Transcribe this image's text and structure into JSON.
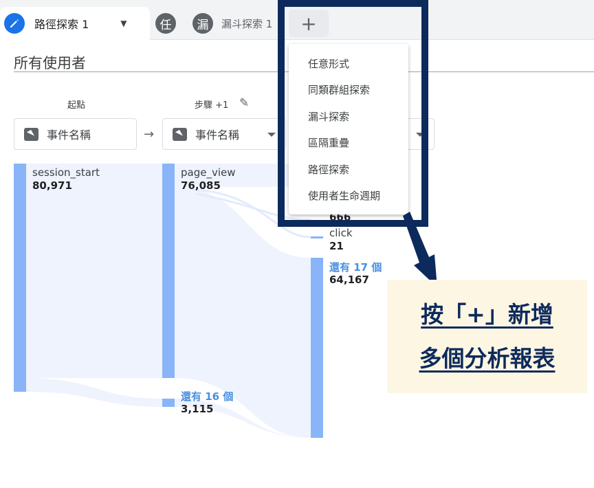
{
  "tabs": [
    {
      "badge": "",
      "label": "路徑探索 1",
      "active": true
    },
    {
      "badge": "任",
      "label": "",
      "active": false
    },
    {
      "badge": "漏",
      "label": "漏斗探索 1",
      "active": false
    }
  ],
  "add_tab_label": "+",
  "segment_title": "所有使用者",
  "steps": [
    {
      "title": "起點",
      "selector": "事件名稱"
    },
    {
      "title": "步驟 +1",
      "selector": "事件名稱"
    }
  ],
  "nodes": {
    "start": {
      "label": "session_start",
      "value": "80,971"
    },
    "step1_main": {
      "label": "page_view",
      "value": "76,085"
    },
    "step1_more": {
      "label": "還有 16 個",
      "value": "3,115"
    },
    "step2_hidden_value": "666",
    "step2_click": {
      "label": "click",
      "value": "21"
    },
    "step2_more": {
      "label": "還有 17 個",
      "value": "64,167"
    }
  },
  "menu": {
    "items": [
      "任意形式",
      "同類群組探索",
      "漏斗探索",
      "區隔重疊",
      "路徑探索",
      "使用者生命週期"
    ]
  },
  "callout": {
    "line1": "按「+」新增",
    "line2": "多個分析報表"
  },
  "colors": {
    "node_bar": "#8ab4f8",
    "flow": "#eef3fd",
    "annotation": "#0d2a5c",
    "callout_bg": "#fdf6e3",
    "accent": "#1a73e8"
  }
}
